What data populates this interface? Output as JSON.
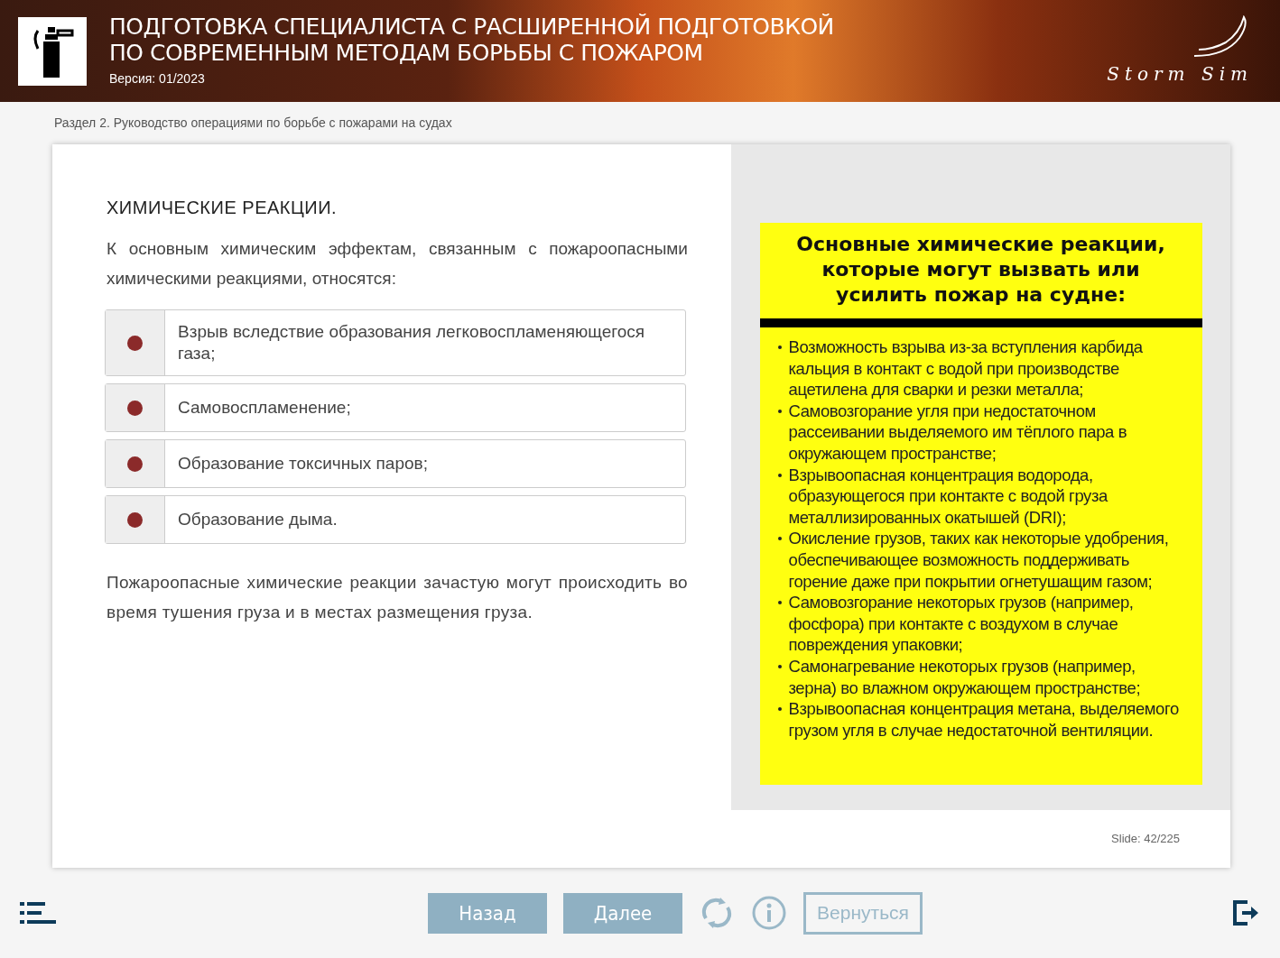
{
  "header": {
    "title_lines": [
      "ПОДГОТОВКА СПЕЦИАЛИСТА С РАСШИРЕННОЙ ПОДГОТОВКОЙ",
      "ПО СОВРЕМЕННЫМ МЕТОДАМ БОРЬБЫ С ПОЖАРОМ"
    ],
    "version": "Версия: 01/2023",
    "logo_text": "Storm Sim"
  },
  "breadcrumb": "Раздел 2. Руководство операциями по борьбе с пожарами на судах",
  "slide": {
    "heading": "ХИМИЧЕСКИЕ РЕАКЦИИ.",
    "intro": "К основным химическим эффектам, связанным с пожароопасными химическими реакциями, относятся:",
    "items": [
      {
        "text": "Взрыв вследствие образования легковоспламеняющегося газа;"
      },
      {
        "text": "Самовоспламенение;"
      },
      {
        "text": "Образование токсичных паров;"
      },
      {
        "text": "Образование дыма."
      }
    ],
    "outro": "Пожароопасные химические реакции зачастую могут происходить во время тушения груза и в местах размещения груза.",
    "poster": {
      "title": "Основные химические реакции, которые могут вызвать или усилить пожар на судне:",
      "bullets": [
        "Возможность взрыва из-за вступления карбида кальция в контакт с водой при производстве ацетилена для сварки и резки металла;",
        "Самовозгорание угля при недостаточном рассеивании выделяемого им тёплого пара в окружающем пространстве;",
        "Взрывоопасная концентрация водорода, образующегося при контакте с водой груза металлизированных окатышей (DRI);",
        "Окисление грузов, таких как некоторые удобрения, обеспечивающее возможность поддерживать горение даже при покрытии огнетушащим газом;",
        "Самовозгорание некоторых грузов (например, фосфора) при контакте с воздухом в случае повреждения упаковки;",
        "Самонагревание некоторых грузов (например, зерна) во влажном окружающем пространстве;",
        "Взрывоопасная концентрация метана, выделяемого грузом угля в случае недостаточной вентиляции."
      ]
    },
    "counter": "Slide: 42/225"
  },
  "footer": {
    "buttons": [
      {
        "label": "Назад",
        "kind": "filled"
      },
      {
        "label": "Далее",
        "kind": "filled"
      },
      {
        "label": "Вернуться",
        "kind": "outline"
      }
    ]
  }
}
